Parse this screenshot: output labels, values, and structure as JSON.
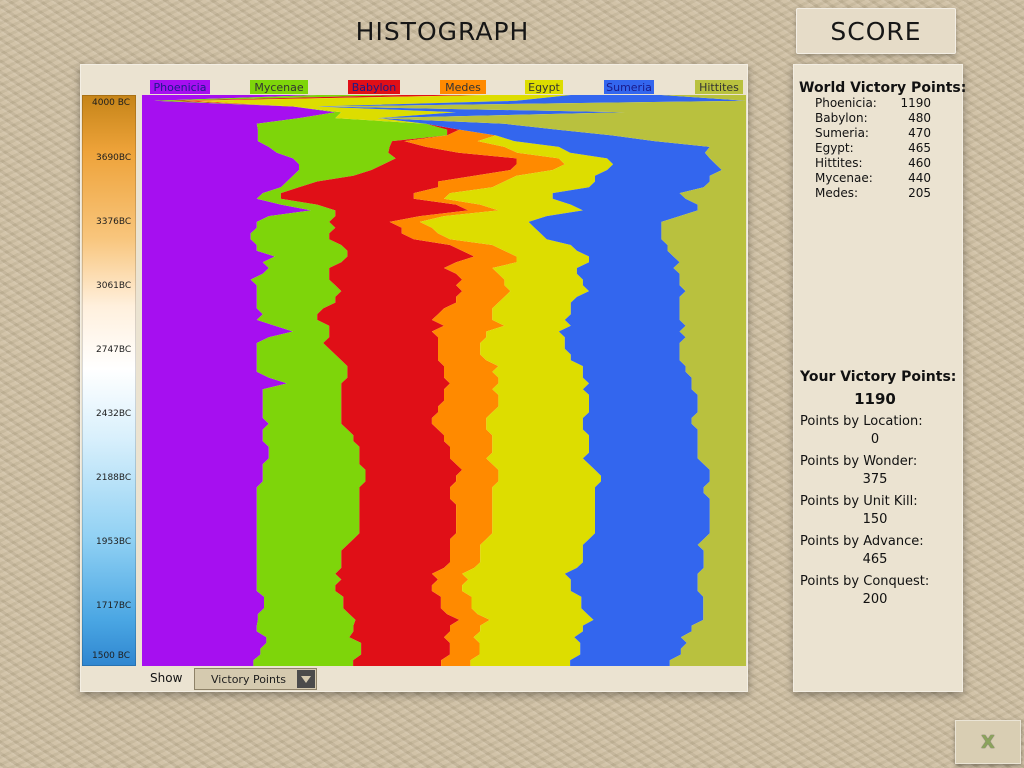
{
  "header": {
    "histograph_title": "HISTOGRAPH",
    "score_title": "SCORE"
  },
  "timeline": {
    "ticks": [
      "4000 BC",
      "3690BC",
      "3376BC",
      "3061BC",
      "2747BC",
      "2432BC",
      "2188BC",
      "1953BC",
      "1717BC",
      "1500 BC"
    ]
  },
  "controls": {
    "show_label": "Show",
    "show_value": "Victory Points"
  },
  "world_victory_points": {
    "title": "World Victory Points:",
    "rows": [
      {
        "name": "Phoenicia:",
        "value": "1190"
      },
      {
        "name": "Babylon:",
        "value": "480"
      },
      {
        "name": "Sumeria:",
        "value": "470"
      },
      {
        "name": "Egypt:",
        "value": "465"
      },
      {
        "name": "Hittites:",
        "value": "460"
      },
      {
        "name": "Mycenae:",
        "value": "440"
      },
      {
        "name": "Medes:",
        "value": "205"
      }
    ]
  },
  "your_victory_points": {
    "title": "Your Victory Points:",
    "total": "1190",
    "breakdown": [
      {
        "label": "Points by Location:",
        "value": "0"
      },
      {
        "label": "Points by Wonder:",
        "value": "375"
      },
      {
        "label": "Points by Unit Kill:",
        "value": "150"
      },
      {
        "label": "Points by Advance:",
        "value": "465"
      },
      {
        "label": "Points by Conquest:",
        "value": "200"
      }
    ]
  },
  "close_button": {
    "label": "X",
    "icon": "close-icon"
  },
  "chart_data": {
    "type": "area",
    "orientation": "vertical-stacked",
    "xlabel": "",
    "ylabel": "",
    "y_ticks": [
      "4000 BC",
      "3690BC",
      "3376BC",
      "3061BC",
      "2747BC",
      "2432BC",
      "2188BC",
      "1953BC",
      "1717BC",
      "1500 BC"
    ],
    "series": [
      {
        "name": "Phoenicia",
        "color": "#a60ff0",
        "values": [
          0.29,
          0.02,
          0.25,
          0.32,
          0.26,
          0.19,
          0.19,
          0.19,
          0.19,
          0.21,
          0.23,
          0.25,
          0.26,
          0.26,
          0.25,
          0.24,
          0.23,
          0.2,
          0.19,
          0.23,
          0.28,
          0.21,
          0.19,
          0.19,
          0.18,
          0.18,
          0.19,
          0.19,
          0.22,
          0.2,
          0.21,
          0.2,
          0.18,
          0.19,
          0.19,
          0.19,
          0.19,
          0.19,
          0.2,
          0.19,
          0.22,
          0.25,
          0.21,
          0.19,
          0.19,
          0.19,
          0.19,
          0.19,
          0.19,
          0.21,
          0.24,
          0.2,
          0.2,
          0.2,
          0.2,
          0.2,
          0.2,
          0.21,
          0.2,
          0.2,
          0.2,
          0.21,
          0.21,
          0.21,
          0.2,
          0.2,
          0.2,
          0.2,
          0.19,
          0.19,
          0.19,
          0.19,
          0.19,
          0.19,
          0.19,
          0.19,
          0.19,
          0.19,
          0.19,
          0.19,
          0.19,
          0.19,
          0.19,
          0.19,
          0.19,
          0.19,
          0.19,
          0.2,
          0.2,
          0.2,
          0.19,
          0.19,
          0.19,
          0.19,
          0.21,
          0.21,
          0.2,
          0.2,
          0.19,
          0.19
        ]
      },
      {
        "name": "Mycenae",
        "color": "#7ed50a",
        "values": [
          0.14,
          0.03,
          0.0,
          0.01,
          0.06,
          0.28,
          0.31,
          0.31,
          0.22,
          0.2,
          0.19,
          0.17,
          0.14,
          0.12,
          0.1,
          0.05,
          0.03,
          0.03,
          0.04,
          0.06,
          0.04,
          0.11,
          0.12,
          0.13,
          0.13,
          0.13,
          0.14,
          0.15,
          0.12,
          0.13,
          0.1,
          0.11,
          0.13,
          0.13,
          0.14,
          0.13,
          0.13,
          0.11,
          0.09,
          0.1,
          0.09,
          0.06,
          0.1,
          0.11,
          0.12,
          0.13,
          0.14,
          0.15,
          0.15,
          0.13,
          0.09,
          0.13,
          0.13,
          0.13,
          0.13,
          0.13,
          0.13,
          0.12,
          0.14,
          0.15,
          0.15,
          0.15,
          0.15,
          0.15,
          0.16,
          0.17,
          0.17,
          0.17,
          0.17,
          0.17,
          0.17,
          0.17,
          0.17,
          0.17,
          0.17,
          0.17,
          0.17,
          0.16,
          0.15,
          0.14,
          0.14,
          0.14,
          0.14,
          0.13,
          0.14,
          0.13,
          0.13,
          0.13,
          0.13,
          0.13,
          0.15,
          0.16,
          0.16,
          0.16,
          0.14,
          0.16,
          0.17,
          0.17,
          0.17,
          0.17
        ]
      },
      {
        "name": "Babylon",
        "color": "#e00f17",
        "values": [
          0.14,
          0.02,
          0.0,
          0.0,
          0.0,
          0.0,
          0.02,
          0.0,
          0.02,
          0.06,
          0.12,
          0.2,
          0.22,
          0.23,
          0.2,
          0.2,
          0.23,
          0.22,
          0.22,
          0.23,
          0.22,
          0.14,
          0.1,
          0.11,
          0.12,
          0.14,
          0.18,
          0.19,
          0.21,
          0.19,
          0.19,
          0.21,
          0.22,
          0.2,
          0.2,
          0.2,
          0.2,
          0.2,
          0.2,
          0.19,
          0.19,
          0.17,
          0.18,
          0.19,
          0.18,
          0.17,
          0.16,
          0.16,
          0.16,
          0.16,
          0.18,
          0.17,
          0.17,
          0.17,
          0.16,
          0.16,
          0.15,
          0.15,
          0.15,
          0.15,
          0.15,
          0.15,
          0.15,
          0.15,
          0.16,
          0.16,
          0.15,
          0.15,
          0.15,
          0.15,
          0.15,
          0.16,
          0.16,
          0.16,
          0.16,
          0.16,
          0.16,
          0.16,
          0.17,
          0.18,
          0.18,
          0.18,
          0.17,
          0.16,
          0.16,
          0.16,
          0.16,
          0.16,
          0.16,
          0.16,
          0.16,
          0.17,
          0.16,
          0.16,
          0.16,
          0.15,
          0.15,
          0.15,
          0.15,
          0.15
        ]
      },
      {
        "name": "Medes",
        "color": "#ff8a00",
        "values": [
          0.0,
          0.02,
          0.0,
          0.0,
          0.0,
          0.0,
          0.0,
          0.08,
          0.12,
          0.13,
          0.1,
          0.07,
          0.08,
          0.07,
          0.07,
          0.11,
          0.09,
          0.06,
          0.05,
          0.04,
          0.05,
          0.04,
          0.05,
          0.05,
          0.06,
          0.06,
          0.07,
          0.07,
          0.07,
          0.1,
          0.08,
          0.07,
          0.07,
          0.08,
          0.08,
          0.08,
          0.07,
          0.08,
          0.09,
          0.1,
          0.1,
          0.09,
          0.08,
          0.07,
          0.07,
          0.07,
          0.08,
          0.09,
          0.08,
          0.09,
          0.08,
          0.08,
          0.09,
          0.09,
          0.1,
          0.09,
          0.09,
          0.09,
          0.08,
          0.08,
          0.08,
          0.07,
          0.07,
          0.06,
          0.06,
          0.06,
          0.07,
          0.07,
          0.07,
          0.07,
          0.07,
          0.06,
          0.06,
          0.06,
          0.06,
          0.06,
          0.06,
          0.06,
          0.05,
          0.05,
          0.05,
          0.05,
          0.05,
          0.05,
          0.05,
          0.05,
          0.05,
          0.05,
          0.05,
          0.05,
          0.05,
          0.05,
          0.05,
          0.05,
          0.05,
          0.05,
          0.05,
          0.05,
          0.05,
          0.05
        ]
      },
      {
        "name": "Egypt",
        "color": "#dddd00",
        "values": [
          0.14,
          0.53,
          0.04,
          0.19,
          0.07,
          0.0,
          0.0,
          0.0,
          0.06,
          0.09,
          0.09,
          0.08,
          0.08,
          0.09,
          0.13,
          0.15,
          0.16,
          0.17,
          0.18,
          0.15,
          0.14,
          0.17,
          0.18,
          0.17,
          0.17,
          0.16,
          0.13,
          0.12,
          0.12,
          0.12,
          0.14,
          0.13,
          0.13,
          0.13,
          0.13,
          0.12,
          0.12,
          0.13,
          0.13,
          0.12,
          0.11,
          0.12,
          0.13,
          0.14,
          0.14,
          0.15,
          0.14,
          0.14,
          0.15,
          0.14,
          0.15,
          0.15,
          0.15,
          0.15,
          0.15,
          0.16,
          0.16,
          0.16,
          0.16,
          0.16,
          0.16,
          0.16,
          0.16,
          0.16,
          0.16,
          0.16,
          0.17,
          0.17,
          0.17,
          0.17,
          0.17,
          0.17,
          0.17,
          0.17,
          0.17,
          0.17,
          0.17,
          0.17,
          0.17,
          0.17,
          0.17,
          0.17,
          0.17,
          0.17,
          0.17,
          0.18,
          0.18,
          0.18,
          0.18,
          0.18,
          0.18,
          0.17,
          0.17,
          0.17,
          0.17,
          0.17,
          0.17,
          0.17,
          0.17,
          0.17
        ]
      },
      {
        "name": "Sumeria",
        "color": "#3366ee",
        "values": [
          0.15,
          0.38,
          0.01,
          0.28,
          0.0,
          0.13,
          0.16,
          0.19,
          0.23,
          0.25,
          0.23,
          0.17,
          0.17,
          0.19,
          0.19,
          0.19,
          0.19,
          0.21,
          0.22,
          0.21,
          0.19,
          0.22,
          0.22,
          0.21,
          0.2,
          0.19,
          0.16,
          0.15,
          0.14,
          0.15,
          0.16,
          0.17,
          0.16,
          0.16,
          0.16,
          0.17,
          0.18,
          0.18,
          0.18,
          0.19,
          0.19,
          0.2,
          0.2,
          0.19,
          0.19,
          0.18,
          0.18,
          0.17,
          0.17,
          0.18,
          0.17,
          0.18,
          0.18,
          0.18,
          0.18,
          0.18,
          0.18,
          0.18,
          0.19,
          0.18,
          0.18,
          0.18,
          0.18,
          0.19,
          0.19,
          0.19,
          0.18,
          0.18,
          0.18,
          0.18,
          0.19,
          0.19,
          0.19,
          0.19,
          0.19,
          0.19,
          0.19,
          0.19,
          0.19,
          0.2,
          0.2,
          0.2,
          0.21,
          0.22,
          0.21,
          0.21,
          0.21,
          0.2,
          0.2,
          0.2,
          0.19,
          0.18,
          0.18,
          0.18,
          0.18,
          0.18,
          0.17,
          0.17,
          0.17,
          0.17
        ]
      },
      {
        "name": "Hittites",
        "color": "#b9c13e",
        "values": [
          0.14,
          0.0,
          0.7,
          0.2,
          0.61,
          0.4,
          0.31,
          0.22,
          0.15,
          0.06,
          0.07,
          0.06,
          0.05,
          0.04,
          0.06,
          0.06,
          0.07,
          0.11,
          0.1,
          0.08,
          0.08,
          0.11,
          0.14,
          0.14,
          0.14,
          0.14,
          0.13,
          0.13,
          0.12,
          0.11,
          0.12,
          0.11,
          0.11,
          0.11,
          0.1,
          0.11,
          0.11,
          0.11,
          0.11,
          0.11,
          0.1,
          0.11,
          0.1,
          0.11,
          0.11,
          0.11,
          0.11,
          0.1,
          0.1,
          0.09,
          0.09,
          0.09,
          0.08,
          0.08,
          0.08,
          0.08,
          0.09,
          0.09,
          0.08,
          0.08,
          0.08,
          0.08,
          0.08,
          0.08,
          0.07,
          0.06,
          0.06,
          0.06,
          0.07,
          0.07,
          0.06,
          0.06,
          0.06,
          0.06,
          0.06,
          0.06,
          0.06,
          0.07,
          0.08,
          0.07,
          0.07,
          0.07,
          0.07,
          0.08,
          0.08,
          0.08,
          0.08,
          0.07,
          0.07,
          0.07,
          0.07,
          0.07,
          0.09,
          0.09,
          0.11,
          0.1,
          0.11,
          0.11,
          0.13,
          0.13
        ]
      }
    ],
    "legend_placement": "top",
    "grid": false
  }
}
